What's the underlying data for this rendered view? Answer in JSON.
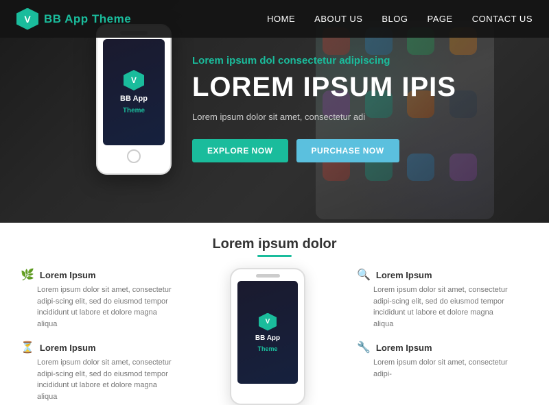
{
  "navbar": {
    "logo_icon": "V",
    "logo_text": "BB App Theme",
    "links": [
      {
        "label": "HOME",
        "active": true
      },
      {
        "label": "ABOUT US"
      },
      {
        "label": "BLOG"
      },
      {
        "label": "PAGE"
      },
      {
        "label": "CONTACT US"
      }
    ]
  },
  "hero": {
    "subtitle_plain": "Lorem ipsum dol ",
    "subtitle_accent": "consectetur",
    "subtitle_end": " adipiscing",
    "title": "LOREM IPSUM IPIS",
    "description": "Lorem ipsum dolor sit amet, consectetur adi",
    "btn_explore": "EXPLORE NOW",
    "btn_purchase": "PURCHASE NOW",
    "mockup": {
      "app_name": "BB App",
      "theme_label": "Theme",
      "hex_label": "V"
    }
  },
  "features": {
    "section_title": "Lorem ipsum dolor",
    "divider_color": "#1abc9c",
    "left_col": [
      {
        "icon": "🌿",
        "title": "Lorem Ipsum",
        "desc": "Lorem ipsum dolor sit amet, consectetur adipi-scing elit, sed do eiusmod tempor incididunt ut labore et dolore magna aliqua"
      },
      {
        "icon": "⏳",
        "title": "Lorem Ipsum",
        "desc": "Lorem ipsum dolor sit amet, consectetur adipi-scing elit, sed do eiusmod tempor incididunt ut labore et dolore magna aliqua"
      }
    ],
    "right_col": [
      {
        "icon": "🔍",
        "title": "Lorem Ipsum",
        "desc": "Lorem ipsum dolor sit amet, consectetur adipi-scing elit, sed do eiusmod tempor incididunt ut labore et dolore magna aliqua"
      },
      {
        "icon": "🔧",
        "title": "Lorem Ipsum",
        "desc": "Lorem ipsum dolor sit amet, consectetur adipi-"
      }
    ],
    "center_phone": {
      "hex_label": "V",
      "app_name": "BB App",
      "theme_label": "Theme"
    }
  }
}
